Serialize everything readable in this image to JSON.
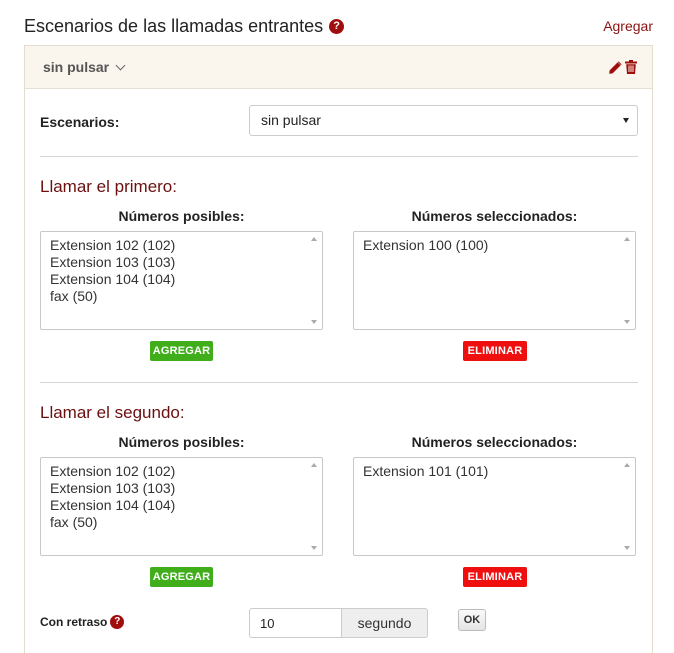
{
  "header": {
    "title": "Escenarios de las llamadas entrantes",
    "add_label": "Agregar"
  },
  "panel": {
    "title": "sin pulsar",
    "scenario_label": "Escenarios:",
    "scenario_value": "sin pulsar"
  },
  "sections": [
    {
      "title": "Llamar el primero:",
      "available_label": "Números posibles:",
      "selected_label": "Números seleccionados:",
      "available": [
        "Extension 102 (102)",
        "Extension 103 (103)",
        "Extension 104 (104)",
        "fax (50)"
      ],
      "selected": [
        "Extension 100 (100)"
      ],
      "add_button": "AGREGAR",
      "remove_button": "ELIMINAR"
    },
    {
      "title": "Llamar el segundo:",
      "available_label": "Números posibles:",
      "selected_label": "Números seleccionados:",
      "available": [
        "Extension 102 (102)",
        "Extension 103 (103)",
        "Extension 104 (104)",
        "fax (50)"
      ],
      "selected": [
        "Extension 101 (101)"
      ],
      "add_button": "AGREGAR",
      "remove_button": "ELIMINAR"
    }
  ],
  "delay": {
    "label": "Con retraso",
    "value": "10",
    "unit": "segundo",
    "ok_label": "OK"
  },
  "icons": {
    "help": "question-circle-icon",
    "edit": "pencil-icon",
    "delete": "trash-icon",
    "expand": "chevron-down-icon"
  },
  "colors": {
    "accent": "#8b1111",
    "add_button": "#3fae1a",
    "remove_button": "#ef0f0f",
    "panel_header": "#faf6ed"
  }
}
